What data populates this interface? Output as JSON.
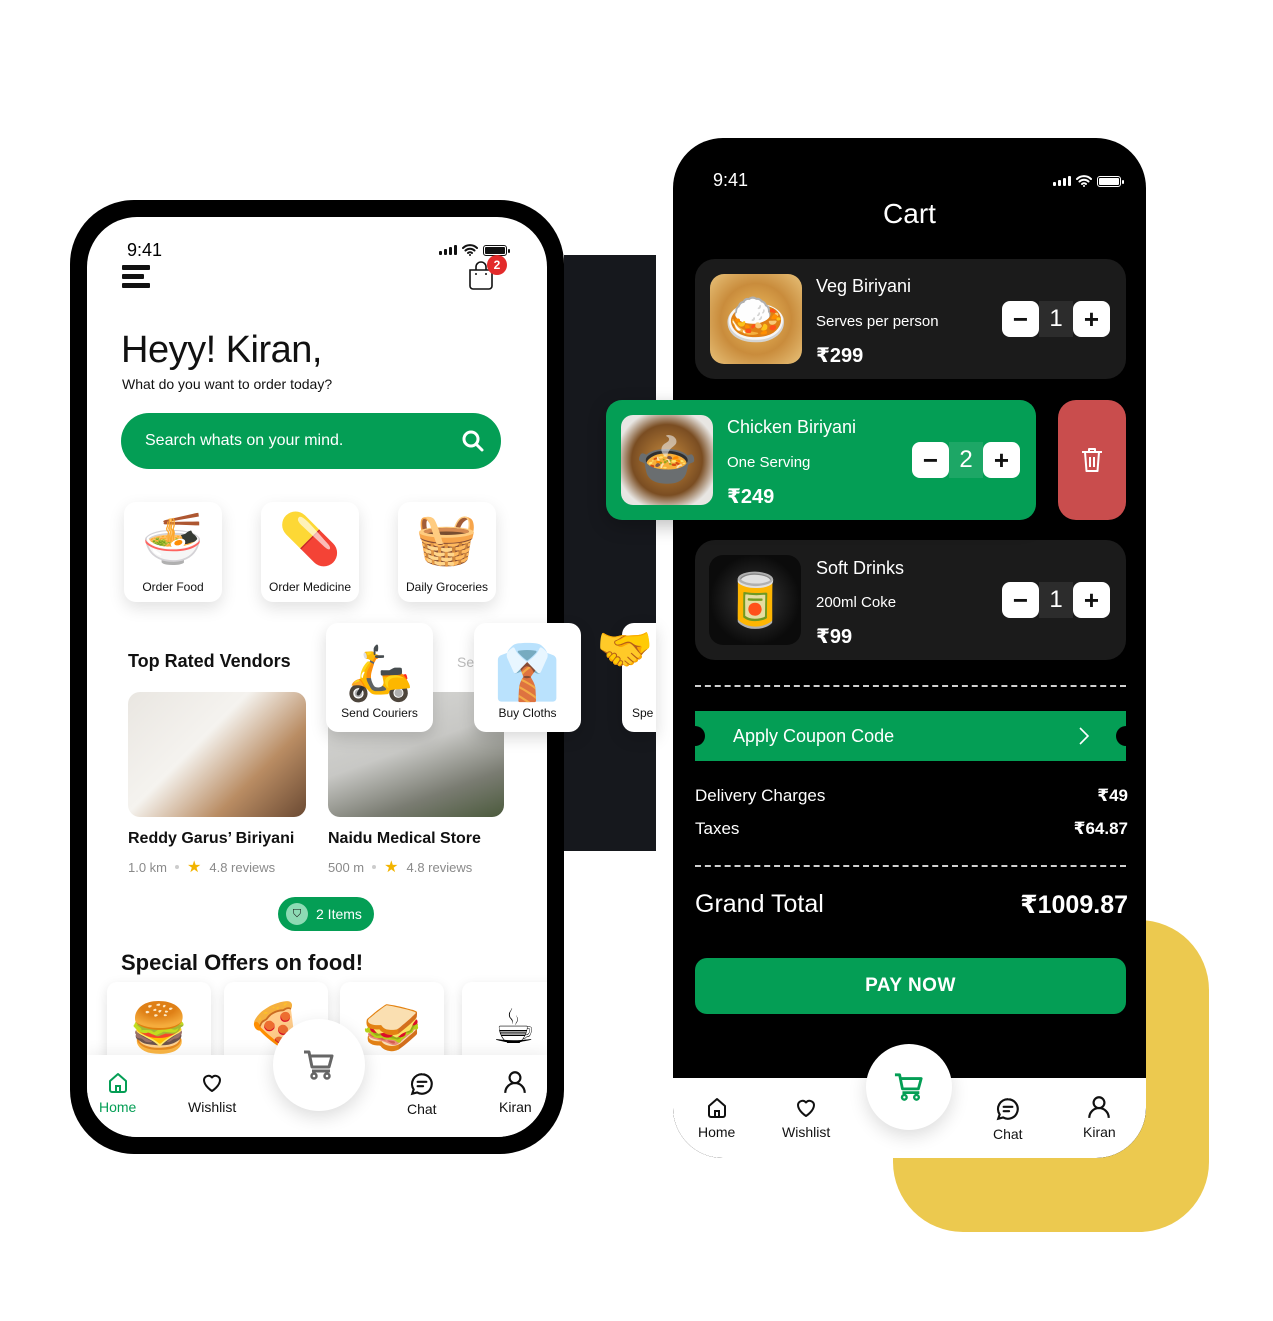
{
  "home": {
    "status_time": "9:41",
    "cart_badge": "2",
    "greeting": "Heyy! Kiran,",
    "subtitle": "What do you want to order today?",
    "search_placeholder": "Search whats on your mind.",
    "categories": [
      {
        "label": "Order Food",
        "icon": "noodle-bowl"
      },
      {
        "label": "Order Medicine",
        "icon": "medicine-bottle"
      },
      {
        "label": "Daily Groceries",
        "icon": "grocery-basket"
      }
    ],
    "more_categories": [
      {
        "label": "Send Couriers",
        "icon": "courier-scooter"
      },
      {
        "label": "Buy Cloths",
        "icon": "shirt-hanger"
      },
      {
        "label": "Spe",
        "icon": "handshake"
      }
    ],
    "top_rated_title": "Top Rated Vendors",
    "see_all_partial": "Se",
    "vendors": [
      {
        "name": "Reddy Garus’ Biriyani",
        "distance": "1.0 km",
        "rating": "4.8 reviews"
      },
      {
        "name": "Naidu Medical Store",
        "distance": "500 m",
        "rating": "4.8 reviews"
      }
    ],
    "items_pill": "2 Items",
    "special_offers_title": "Special Offers on food!",
    "offers": [
      {
        "icon": "burger"
      },
      {
        "icon": "pizza"
      },
      {
        "icon": "sandwich"
      },
      {
        "icon": "coffee"
      }
    ],
    "nav": [
      {
        "label": "Home",
        "icon": "home-icon",
        "active": true
      },
      {
        "label": "Wishlist",
        "icon": "heart-icon"
      },
      {
        "label": "Chat",
        "icon": "chat-icon"
      },
      {
        "label": "Kiran",
        "icon": "user-icon"
      }
    ]
  },
  "cart": {
    "status_time": "9:41",
    "title": "Cart",
    "items": [
      {
        "name": "Veg Biriyani",
        "desc": "Serves per person",
        "price": "₹299",
        "qty": "1"
      },
      {
        "name": "Chicken Biriyani",
        "desc": "One Serving",
        "price": "₹249",
        "qty": "2"
      },
      {
        "name": "Soft Drinks",
        "desc": "200ml Coke",
        "price": "₹99",
        "qty": "1"
      }
    ],
    "coupon_label": "Apply Coupon Code",
    "delivery_label": "Delivery Charges",
    "delivery_value": "₹49",
    "taxes_label": "Taxes",
    "taxes_value": "₹64.87",
    "grand_total_label": "Grand Total",
    "grand_total_value": "₹1009.87",
    "pay_label": "PAY NOW",
    "nav": [
      {
        "label": "Home",
        "icon": "home-icon"
      },
      {
        "label": "Wishlist",
        "icon": "heart-icon"
      },
      {
        "label": "Chat",
        "icon": "chat-icon"
      },
      {
        "label": "Kiran",
        "icon": "user-icon"
      }
    ]
  },
  "colors": {
    "brand_green": "#049e55",
    "delete_red": "#c94d4d",
    "accent_yellow": "#ecc94f",
    "badge_red": "#e32b2b"
  }
}
